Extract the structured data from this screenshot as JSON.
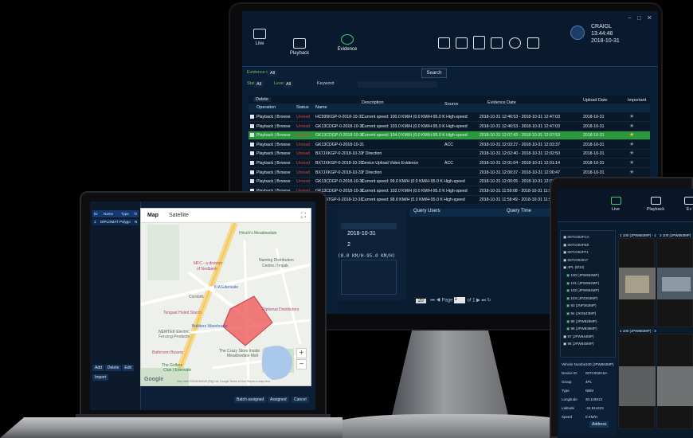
{
  "monitor": {
    "nav_tabs": [
      {
        "label": "Live"
      },
      {
        "label": "Playback"
      },
      {
        "label": "Evidence"
      }
    ],
    "user": {
      "name": "CRAIGL",
      "time": "13:44:48",
      "date": "2018-10-31"
    },
    "filters": {
      "evidence_date_label": "Evidence date",
      "evidence_date_value": "All",
      "state_label": "State",
      "state_value": "All",
      "level_label": "Level",
      "level_value": "All",
      "keyword_label": "Keyword",
      "search_label": "Search"
    },
    "table": {
      "delete_label": "Delete",
      "headers": {
        "operation": "Operation",
        "status": "Status",
        "name": "Name",
        "description": "Description",
        "source": "Source",
        "evidence_date": "Evidence Date",
        "upload_date": "Upload Date",
        "important": "Important"
      },
      "rows": [
        {
          "op": "Playback | Browse",
          "status": "Unread",
          "name": "HC595KGP-0-2018-10-31",
          "desc": "Current speed: 100.0 KM/H (0.0 KM/H-95.0 K High-speed",
          "source": "",
          "date": "2018-10-31 12:46:53 - 2018-10-31 12:47:03",
          "upload": "2018-10-31",
          "star": "★",
          "selected": false
        },
        {
          "op": "Playback | Browse",
          "status": "Unread",
          "name": "GK13CDGP-0-2018-10-31",
          "desc": "Current speed: 103.0 KM/H (0.0 KM/H-95.0 K High-speed",
          "source": "",
          "date": "2018-10-31 12:46:53 - 2018-10-31 12:47:03",
          "upload": "2018-10-31",
          "star": "★",
          "selected": false
        },
        {
          "op": "Playback | Browse",
          "status": "Unread",
          "name": "GK13CDGP-0-2018-10-31",
          "desc": "Current speed: 104.0 KM/H (0.0 KM/H-95.0 K High-speed",
          "source": "",
          "date": "2018-10-31 12:07:43 - 2018-10-31 12:07:53",
          "upload": "2018-10-31",
          "star": "★",
          "selected": true
        },
        {
          "op": "Playback | Browse",
          "status": "Unread",
          "name": "GK13CDGP-0-2018-10-31",
          "desc": "",
          "source": "ACC",
          "date": "2018-10-31 12:03:27 - 2018-10-31 12:03:37",
          "upload": "2018-10-31",
          "star": "★",
          "selected": false
        },
        {
          "op": "Playback | Browse",
          "status": "Unread",
          "name": "BX7JXKGP-0-2018-10-31",
          "desc": "Y Direction",
          "source": "",
          "date": "2018-10-31 12:02:40 - 2018-10-31 12:02:50",
          "upload": "2018-10-31",
          "star": "★",
          "selected": false
        },
        {
          "op": "Playback | Browse",
          "status": "Unread",
          "name": "BX7JXKGP-0-2018-10-31",
          "desc": "Device Upload Video Evidence",
          "source": "ACC",
          "date": "2018-10-31 12:01:04 - 2018-10-31 12:01:14",
          "upload": "2018-10-31",
          "star": "★",
          "selected": false
        },
        {
          "op": "Playback | Browse",
          "status": "Unread",
          "name": "BX7JXKGP-0-2018-10-31",
          "desc": "Y Direction",
          "source": "",
          "date": "2018-10-31 12:00:37 - 2018-10-31 12:00:47",
          "upload": "2018-10-31",
          "star": "★",
          "selected": false
        },
        {
          "op": "Playback | Browse",
          "status": "Unread",
          "name": "GK13CDGP-0-2018-10-31",
          "desc": "Current speed: 99.0 KM/H (0.0 KM/H-95.0 K High-speed",
          "source": "",
          "date": "2018-10-31 12:00:05 - 2018-10-31 12:00:15",
          "upload": "2018-10-31",
          "star": "★",
          "selected": false
        },
        {
          "op": "Playback | Browse",
          "status": "Unread",
          "name": "GK13CDGP-0-2018-10-31",
          "desc": "Current speed: 102.0 KM/H (0.0 KM/H-95.0 K High-speed",
          "source": "",
          "date": "2018-10-31 11:59:08 - 2018-10-31 11:59:18",
          "upload": "2018-10-31",
          "star": "★",
          "selected": false
        },
        {
          "op": "Playback | Browse",
          "status": "Unread",
          "name": "DY235TGP-0-2018-10-31",
          "desc": "Current speed: 98.0 KM/H (0.0 KM/H-95.0 K High-speed",
          "source": "",
          "date": "2018-10-31 11:58:49 - 2018-10-31 11:58:59",
          "upload": "2018-10-31",
          "star": "★",
          "selected": false
        }
      ]
    },
    "lower": {
      "date_value": "2018-10-31",
      "value_two": "2",
      "mono_line": "(0.0 KM/H-95.0 KM/H)",
      "query_users": "Query Users",
      "query_time": "Query Time",
      "page_size": "20",
      "page_label": "Page",
      "page_value": "1",
      "page_of": "of 1"
    }
  },
  "laptop": {
    "sidebar_headers": {
      "id": "ID",
      "name": "Name",
      "type": "Type",
      "tr": "Tr"
    },
    "sidebar_row": {
      "id": "1",
      "name": "DIPLOMAT",
      "type": "Polygo",
      "tr": "N"
    },
    "sidebar_buttons": [
      "Add",
      "Delete",
      "Edit"
    ],
    "import_label": "Import",
    "map": {
      "tab_map": "Map",
      "tab_satellite": "Satellite",
      "labels": [
        "Hirsch's Meadowdale",
        "Namlog Distribution",
        "Centre / Impak",
        "MFC - a division",
        "of Nedbank",
        "KIA Edenvale",
        "Corobrik",
        "Tongaat Hulett Starch",
        "Diplomat Distributors",
        "Builders Warehouse",
        "NEMTEK Electric",
        "Fencing Products",
        "Bathroom Bizarre",
        "The Crazy Store Inside",
        "Meadowdale Mall",
        "The Golfers",
        "Club | Edenvale"
      ],
      "zoom_in": "+",
      "zoom_out": "−",
      "google": "Google",
      "attribution": "Map data ©2018 AfriGIS (Pty) Ltd, Google  Terms of Use  Report a map error"
    },
    "bottom_buttons": [
      "Batch assigned",
      "Assigned",
      "Cancel"
    ]
  },
  "tablet": {
    "nav_tabs": [
      {
        "label": "Live"
      },
      {
        "label": "Playback"
      },
      {
        "label": "Ev"
      }
    ],
    "tree": [
      {
        "text": "007C002FCA",
        "green": false
      },
      {
        "text": "007C002FE8",
        "green": false
      },
      {
        "text": "007C002FF1",
        "green": false
      },
      {
        "text": "007C002017",
        "green": false
      },
      {
        "text": "4PL (8/10)",
        "green": false
      },
      {
        "text": "100 (JPW863MP)",
        "green": true
      },
      {
        "text": "101 (JPW862MP)",
        "green": true
      },
      {
        "text": "102 (JPW864MP)",
        "green": true
      },
      {
        "text": "103 (JPZ263MP)",
        "green": true
      },
      {
        "text": "93 (JNP363MP)",
        "green": true
      },
      {
        "text": "94 (JKS543MP)",
        "green": true
      },
      {
        "text": "95 (JPW828MP)",
        "green": true
      },
      {
        "text": "96 (JPW838MP)",
        "green": true
      },
      {
        "text": "97 (JPW844MP)",
        "green": false
      },
      {
        "text": "98 (JPW845MP)",
        "green": false
      }
    ],
    "info": [
      {
        "k": "Vehicle Numbe",
        "v": "100 (JPW863MP)"
      },
      {
        "k": "Device ID",
        "v": "007C002HSA"
      },
      {
        "k": "Group",
        "v": "4PL"
      },
      {
        "k": "Type",
        "v": "NBM"
      },
      {
        "k": "Longitude",
        "v": "30.119913"
      },
      {
        "k": "Latitude",
        "v": "-24.814423"
      },
      {
        "k": "Speed",
        "v": "0 KM/H"
      }
    ],
    "video_labels": [
      "1 100 (JPW863MP) - 1",
      "2 100 (JPW863MP)",
      "1 100 (JPW863MP) - 3"
    ],
    "address_label": "Address"
  },
  "colors": {
    "selected_row": "#2b9a3a",
    "status_unread": "#d94141",
    "active_tab": "#3cd06a",
    "geofence": "#ef5b5b"
  }
}
